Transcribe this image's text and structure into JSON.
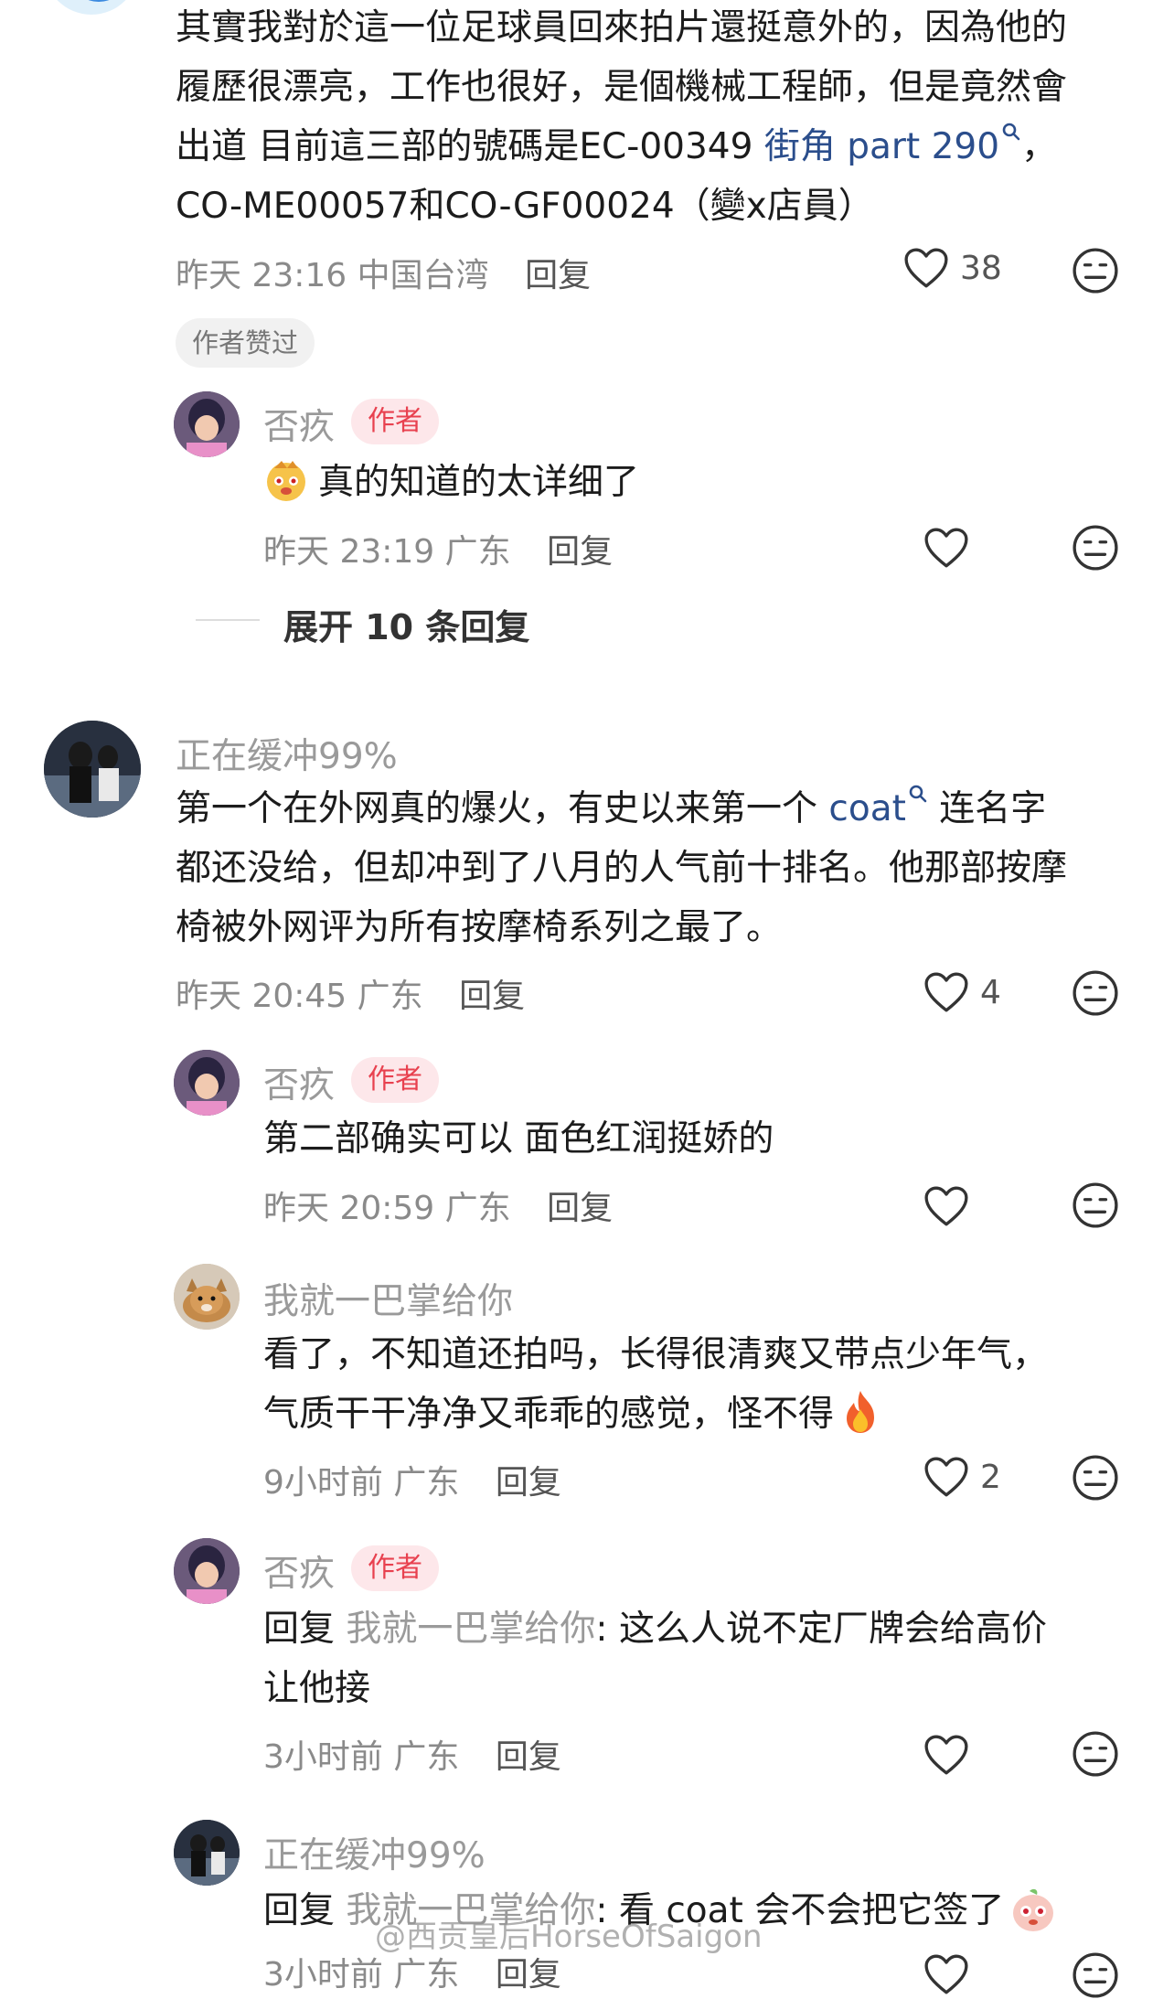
{
  "comment1": {
    "lines": [
      "其實我對於這一位足球員回來拍片還挺意外的，因為他的",
      "履歷很漂亮，工作也很好，是個機械工程師，但是竟然會",
      "出道 目前這三部的號碼是EC-00349 ",
      "CO-ME00057和CO-GF00024（變x店員）"
    ],
    "link": "街角 part 290",
    "link_suffix": "，",
    "time": "昨天 23:16 中国台湾",
    "reply_label": "回复",
    "likes": "38",
    "author_praised": "作者赞过"
  },
  "reply1": {
    "name": "否疚",
    "badge": "作者",
    "text": "真的知道的太详细了",
    "time": "昨天 23:19 广东",
    "reply_label": "回复"
  },
  "expand": {
    "label": "展开 10 条回复"
  },
  "comment2": {
    "name": "正在缓冲99%",
    "line1_pre": "第一个在外网真的爆火，有史以来第一个 ",
    "link": "coat",
    "line1_post": " 连名字",
    "line2": "都还没给，但却冲到了八月的人气前十排名。他那部按摩",
    "line3": "椅被外网评为所有按摩椅系列之最了。",
    "time": "昨天 20:45 广东",
    "reply_label": "回复",
    "likes": "4"
  },
  "reply2": {
    "name": "否疚",
    "badge": "作者",
    "text": "第二部确实可以 面色红润挺娇的",
    "time": "昨天 20:59 广东",
    "reply_label": "回复"
  },
  "reply3": {
    "name": "我就一巴掌给你",
    "line1": "看了，不知道还拍吗，长得很清爽又带点少年气，",
    "line2": "气质干干净净又乖乖的感觉，怪不得",
    "time": "9小时前 广东",
    "reply_label": "回复",
    "likes": "2"
  },
  "reply4": {
    "name": "否疚",
    "badge": "作者",
    "prefix": "回复 ",
    "target": "我就一巴掌给你",
    "line1": ": 这么人说不定厂牌会给高价",
    "line2": "让他接",
    "time": "3小时前 广东",
    "reply_label": "回复"
  },
  "reply5": {
    "name": "正在缓冲99%",
    "prefix": "回复 ",
    "target": "我就一巴掌给你",
    "line1": ": 看 coat 会不会把它签了",
    "time": "3小时前 广东",
    "reply_label": "回复"
  },
  "watermark": "@西贡皇后HorseOfSaigon",
  "colors": {
    "author_badge_bg": "#fde7ea",
    "author_badge_text": "#e8414f",
    "link": "#2b4e8c"
  },
  "icons": [
    "heart-icon",
    "neutral-face-icon",
    "search-icon",
    "fire-icon",
    "emoji-icon"
  ]
}
